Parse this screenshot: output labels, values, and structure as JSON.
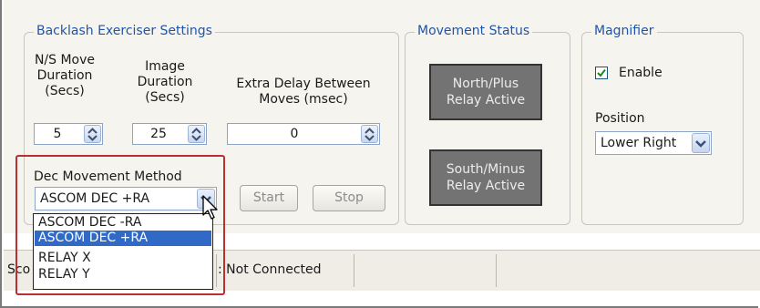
{
  "backlash_group": {
    "title": "Backlash Exerciser Settings",
    "ns_move_label": "N/S Move\nDuration\n(Secs)",
    "ns_move_value": "5",
    "image_duration_label": "Image\nDuration\n(Secs)",
    "image_duration_value": "25",
    "extra_delay_label": "Extra Delay Between\nMoves (msec)",
    "extra_delay_value": "0",
    "dec_method_label": "Dec Movement Method",
    "dec_method_value": "ASCOM DEC +RA",
    "dec_method_options": [
      "ASCOM DEC -RA",
      "ASCOM DEC +RA",
      "RELAY X",
      "RELAY Y"
    ],
    "dec_method_selected_index": 1,
    "start_label": "Start",
    "stop_label": "Stop"
  },
  "movement_status": {
    "title": "Movement Status",
    "north_label": "North/Plus\nRelay Active",
    "south_label": "South/Minus\nRelay Active"
  },
  "magnifier": {
    "title": "Magnifier",
    "enable_label": "Enable",
    "enable_checked": true,
    "position_label": "Position",
    "position_value": "Lower Right"
  },
  "statusbar": {
    "scope_prefix": "Sco",
    "connection_text": ": Not Connected"
  },
  "colors": {
    "group_title": "#1f55a8",
    "relay_bg": "#737373",
    "selection": "#3169c6",
    "highlight_box": "#b83030"
  }
}
